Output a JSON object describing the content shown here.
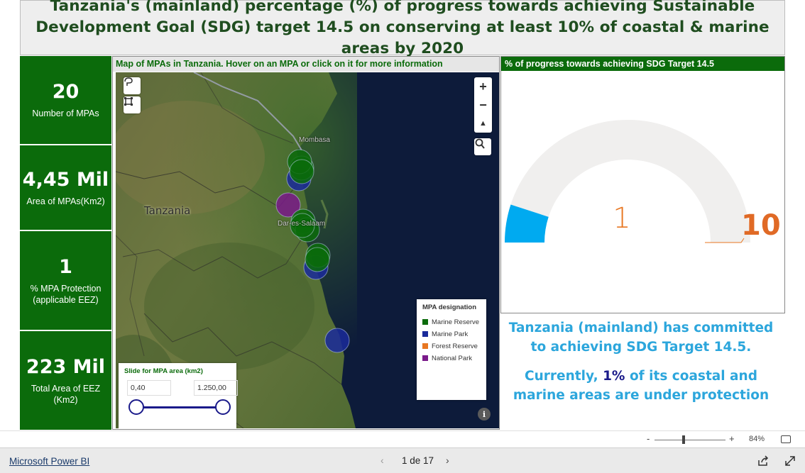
{
  "title": "Tanzania's (mainland) percentage (%) of progress towards achieving Sustainable Development Goal (SDG) target 14.5 on conserving at least 10% of coastal & marine areas by 2020",
  "kpis": [
    {
      "value": "20",
      "label": "Number of MPAs"
    },
    {
      "value": "4,45 Mil",
      "label": "Area of MPAs(Km2)"
    },
    {
      "value": "1",
      "label": "% MPA Protection (applicable EEZ)"
    },
    {
      "value": "223 Mil",
      "label": "Total Area of EEZ (Km2)"
    }
  ],
  "map": {
    "header": "Map of MPAs in Tanzania. Hover on an MPA or click on it for more information",
    "country_label": "Tanzania",
    "cities": [
      "Mombasa",
      "Dar-es-Salaam"
    ],
    "zoom_in": "+",
    "zoom_out": "−",
    "compass": "▲",
    "legend": {
      "title": "MPA designation",
      "items": [
        {
          "label": "Marine Reserve",
          "color": "#0b6b0b"
        },
        {
          "label": "Marine Park",
          "color": "#1a2a9a"
        },
        {
          "label": "Forest Reserve",
          "color": "#e87722"
        },
        {
          "label": "National Park",
          "color": "#7a1a8a"
        }
      ]
    },
    "slider": {
      "title": "Slide for MPA area (km2)",
      "min_value": "0,40",
      "max_value": "1.250,00"
    },
    "info": "i"
  },
  "gauge": {
    "header": "% of progress towards achieving SDG Target 14.5",
    "value": 1,
    "value_text": "1",
    "max": 10,
    "max_text": "10",
    "colors": {
      "fill": "#00aaf0",
      "track": "#f0efee",
      "text": "#e87722"
    }
  },
  "summary": {
    "line1": "Tanzania (mainland) has committed to achieving SDG Target 14.5.",
    "line2_pre": "Currently,",
    "line2_highlight": "1%",
    "line2_post": "of its coastal and marine areas are under protection"
  },
  "zoom_bar": {
    "minus": "-",
    "plus": "+",
    "zoom_level": "84%"
  },
  "footer": {
    "brand_link": "Microsoft Power BI",
    "page_indicator": "1 de 17",
    "prev": "‹",
    "next": "›"
  },
  "colors": {
    "kpi_bg": "#0b6b0b",
    "title_text": "#1f4d1f",
    "summary_text": "#2ca6dc",
    "highlight": "#1a1a8a"
  }
}
